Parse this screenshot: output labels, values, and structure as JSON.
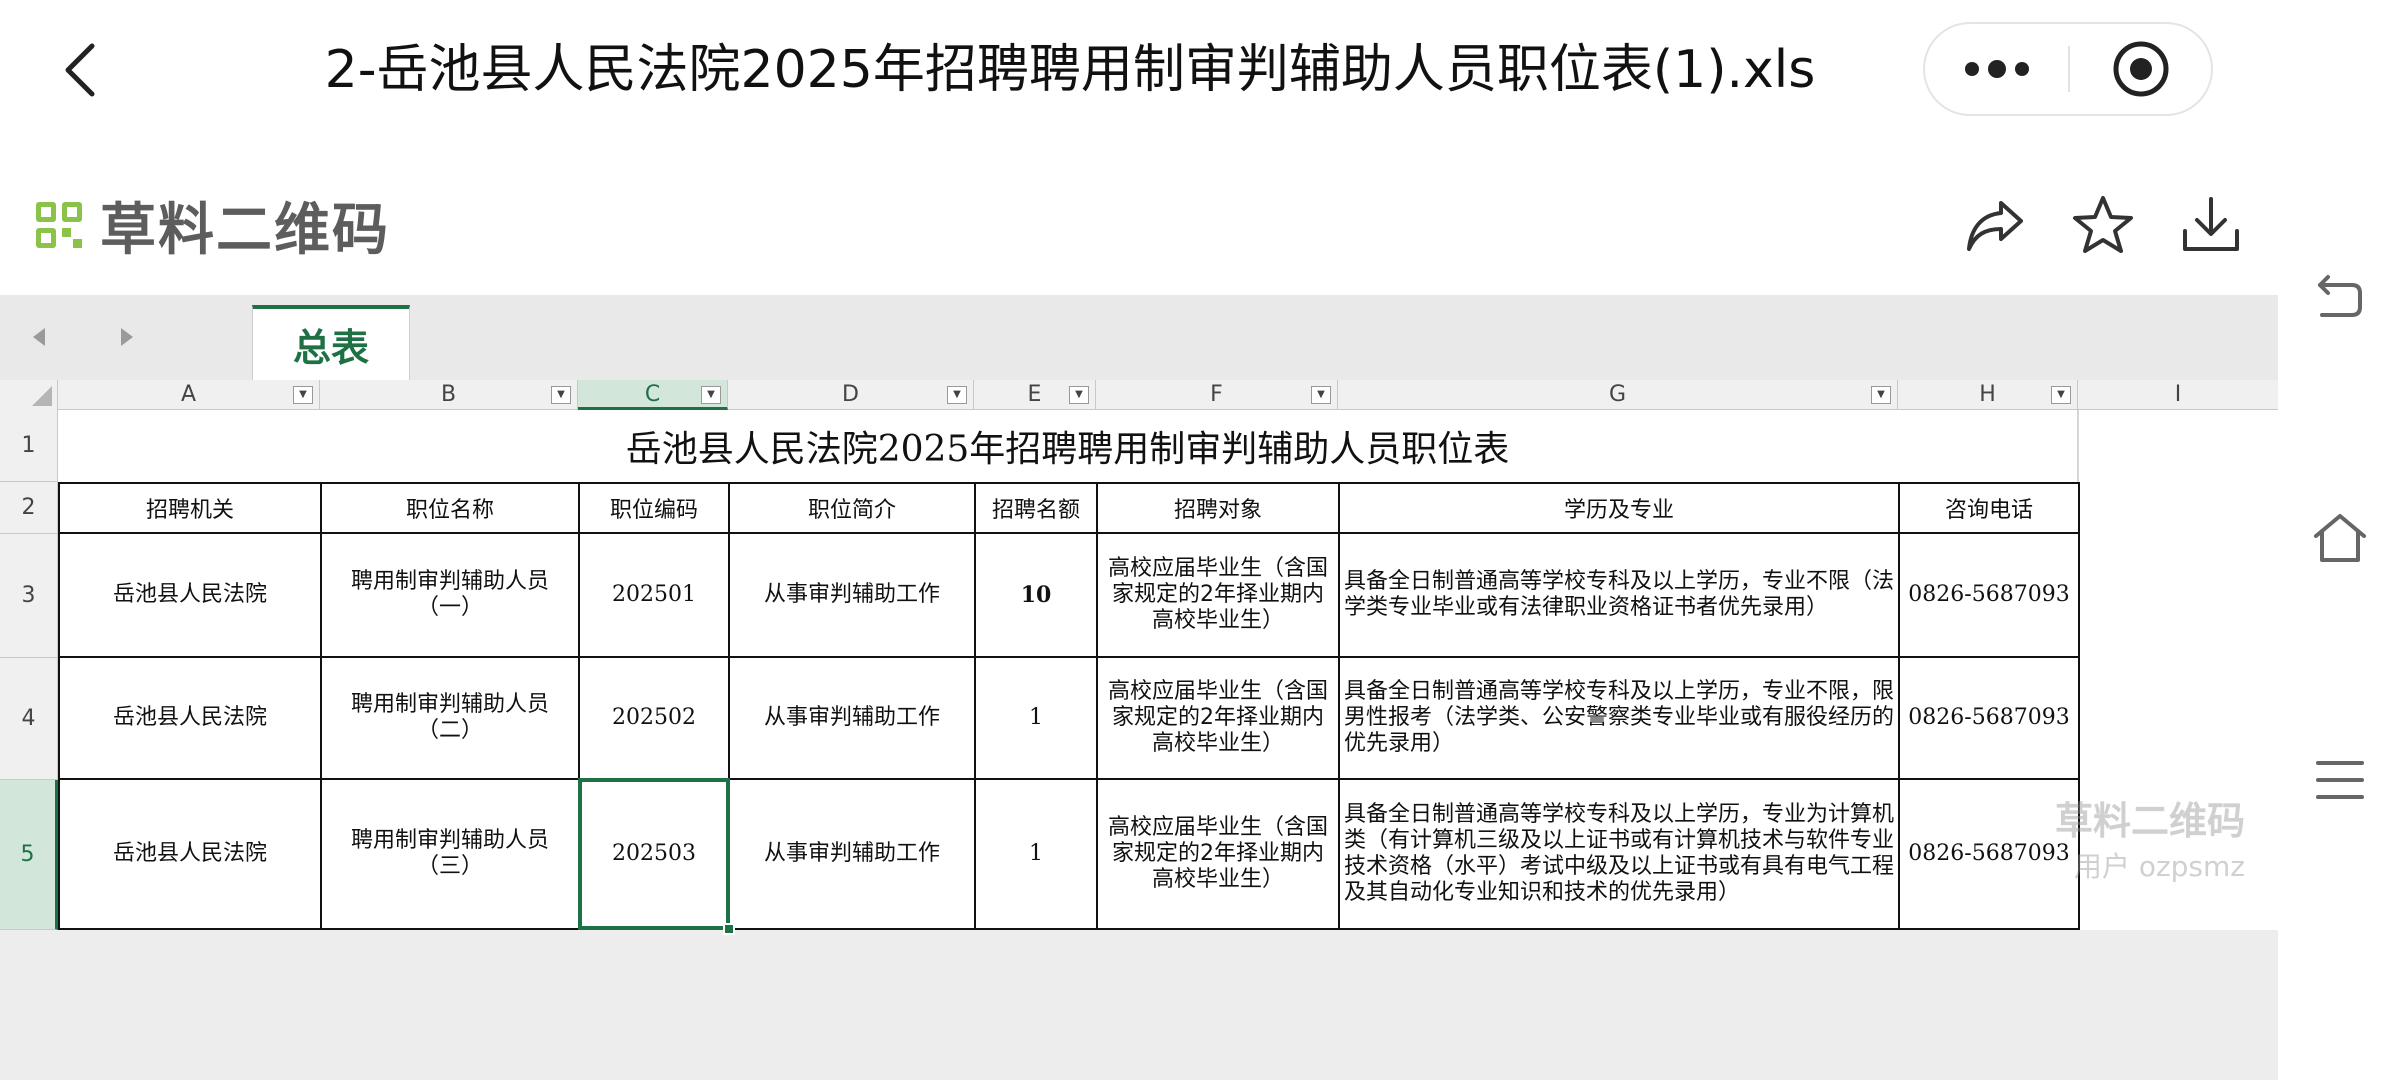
{
  "titlebar": {
    "title": "2-岳池县人民法院2025年招聘聘用制审判辅助人员职位表(1).xls"
  },
  "app": {
    "brand_name": "草料二维码"
  },
  "sheet_tabs": [
    {
      "label": "总表",
      "active": true
    }
  ],
  "columns": [
    "A",
    "B",
    "C",
    "D",
    "E",
    "F",
    "G",
    "H",
    "I"
  ],
  "selected_column": "C",
  "rows": [
    "1",
    "2",
    "3",
    "4",
    "5"
  ],
  "selected_row": "5",
  "table": {
    "title": "岳池县人民法院2025年招聘聘用制审判辅助人员职位表",
    "headers": [
      "招聘机关",
      "职位名称",
      "职位编码",
      "职位简介",
      "招聘名额",
      "招聘对象",
      "学历及专业",
      "咨询电话"
    ],
    "data_rows": [
      [
        "岳池县人民法院",
        "聘用制审判辅助人员（一）",
        "202501",
        "从事审判辅助工作",
        "10",
        "高校应届毕业生（含国家规定的2年择业期内高校毕业生）",
        "具备全日制普通高等学校专科及以上学历，专业不限（法学类专业毕业或有法律职业资格证书者优先录用）",
        "0826-5687093"
      ],
      [
        "岳池县人民法院",
        "聘用制审判辅助人员（二）",
        "202502",
        "从事审判辅助工作",
        "1",
        "高校应届毕业生（含国家规定的2年择业期内高校毕业生）",
        "具备全日制普通高等学校专科及以上学历，专业不限，限男性报考（法学类、公安警察类专业毕业或有服役经历的优先录用）",
        "0826-5687093"
      ],
      [
        "岳池县人民法院",
        "聘用制审判辅助人员（三）",
        "202503",
        "从事审判辅助工作",
        "1",
        "高校应届毕业生（含国家规定的2年择业期内高校毕业生）",
        "具备全日制普通高等学校专科及以上学历，专业为计算机类（有计算机三级及以上证书或有计算机技术与软件专业技术资格（水平）考试中级及以上证书或有具有电气工程及其自动化专业知识和技术的优先录用）",
        "0826-5687093"
      ]
    ]
  },
  "watermark": {
    "line1": "草料二维码",
    "line2": "用户 ozpsmz"
  },
  "colors": {
    "accent": "#1e7145",
    "brand_green": "#8bc34a"
  }
}
